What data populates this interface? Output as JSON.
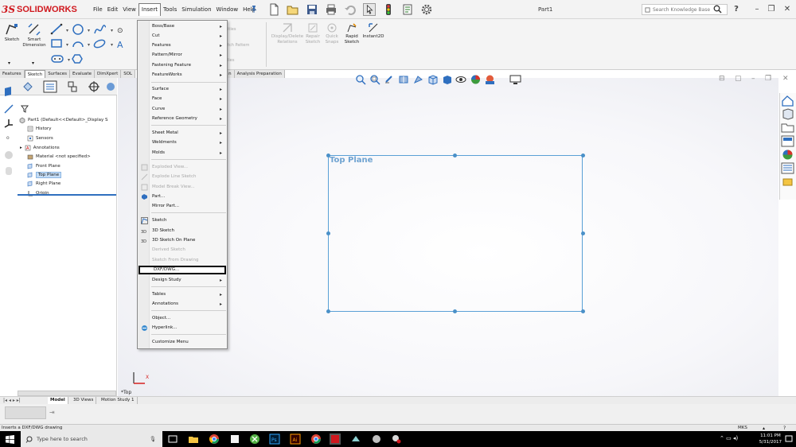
{
  "app": {
    "brand": "SOLIDWORKS",
    "brand_mark": "3S",
    "brand_color": "#d0181e",
    "doc_title": "Part1"
  },
  "menubar": {
    "items": [
      "File",
      "Edit",
      "View",
      "Insert",
      "Tools",
      "Simulation",
      "Window",
      "Help"
    ],
    "active": "Insert",
    "pin_icon": "pin-icon"
  },
  "search": {
    "placeholder": "Search Knowledge Base"
  },
  "ribbon": {
    "sketch": "Sketch",
    "smart_dimension": "Smart Dimension",
    "hidden_labels": [
      "ities",
      "tch Pattern",
      "lies"
    ],
    "display_delete_relations": "Display/Delete Relations",
    "repair_sketch": "Repair Sketch",
    "quick_snaps": "Quick Snaps",
    "rapid_sketch": "Rapid Sketch",
    "instant2d": "Instant2D"
  },
  "command_tabs": [
    "Features",
    "Sketch",
    "Surfaces",
    "Evaluate",
    "DimXpert",
    "SOL",
    "n",
    "Analysis Preparation"
  ],
  "command_tabs_selected": "Sketch",
  "feature_tree": [
    {
      "label": "Part1  (Default<<Default>_Display S",
      "icon": "part-icon"
    },
    {
      "label": "History",
      "icon": "history-icon"
    },
    {
      "label": "Sensors",
      "icon": "sensor-icon"
    },
    {
      "label": "Annotations",
      "icon": "annotations-icon"
    },
    {
      "label": "Material <not specified>",
      "icon": "material-icon"
    },
    {
      "label": "Front Plane",
      "icon": "plane-icon"
    },
    {
      "label": "Top Plane",
      "icon": "plane-icon",
      "selected": true
    },
    {
      "label": "Right Plane",
      "icon": "plane-icon"
    },
    {
      "label": "Origin",
      "icon": "origin-icon"
    }
  ],
  "insert_menu": [
    {
      "label": "Boss/Base",
      "sub": true
    },
    {
      "label": "Cut",
      "sub": true
    },
    {
      "label": "Features",
      "sub": true
    },
    {
      "label": "Pattern/Mirror",
      "sub": true
    },
    {
      "label": "Fastening Feature",
      "sub": true
    },
    {
      "label": "FeatureWorks",
      "sub": true
    },
    {
      "sep": true
    },
    {
      "label": "Surface",
      "sub": true
    },
    {
      "label": "Face",
      "sub": true
    },
    {
      "label": "Curve",
      "sub": true
    },
    {
      "label": "Reference Geometry",
      "sub": true
    },
    {
      "sep": true
    },
    {
      "label": "Sheet Metal",
      "sub": true
    },
    {
      "label": "Weldments",
      "sub": true
    },
    {
      "label": "Molds",
      "sub": true
    },
    {
      "sep": true
    },
    {
      "label": "Exploded View...",
      "disabled": true,
      "icon": "exploded-view-icon"
    },
    {
      "label": "Explode Line Sketch",
      "disabled": true,
      "icon": "explode-line-icon"
    },
    {
      "label": "Model Break View...",
      "disabled": true,
      "icon": "break-view-icon"
    },
    {
      "label": "Part...",
      "icon": "part-insert-icon"
    },
    {
      "label": "Mirror Part..."
    },
    {
      "sep": true
    },
    {
      "label": "Sketch",
      "icon": "sketch-icon"
    },
    {
      "label": "3D Sketch",
      "icon": "3d-sketch-icon"
    },
    {
      "label": "3D Sketch On Plane",
      "icon": "3d-sketch-plane-icon"
    },
    {
      "label": "Derived Sketch",
      "disabled": true
    },
    {
      "label": "Sketch From Drawing",
      "disabled": true
    },
    {
      "label": "DXF/DWG...",
      "highlighted": true
    },
    {
      "label": "Design Study",
      "sub": true
    },
    {
      "sep": true
    },
    {
      "label": "Tables",
      "sub": true
    },
    {
      "label": "Annotations",
      "sub": true
    },
    {
      "sep": true
    },
    {
      "label": "Object..."
    },
    {
      "label": "Hyperlink...",
      "icon": "hyperlink-icon"
    },
    {
      "sep": true
    },
    {
      "label": "Customize Menu"
    }
  ],
  "viewport": {
    "plane_label": "Top Plane",
    "view_name": "*Top",
    "triad_axis": "X",
    "plane_color": "#5aa0d6"
  },
  "bottom_tabs": [
    "Model",
    "3D Views",
    "Motion Study 1"
  ],
  "bottom_tabs_selected": "Model",
  "status": {
    "message": "Inserts a DXF/DWG drawing",
    "units": "MKS"
  },
  "taskbar": {
    "search_placeholder": "Type here to search",
    "time": "11:01 PM",
    "date": "5/31/2017"
  }
}
